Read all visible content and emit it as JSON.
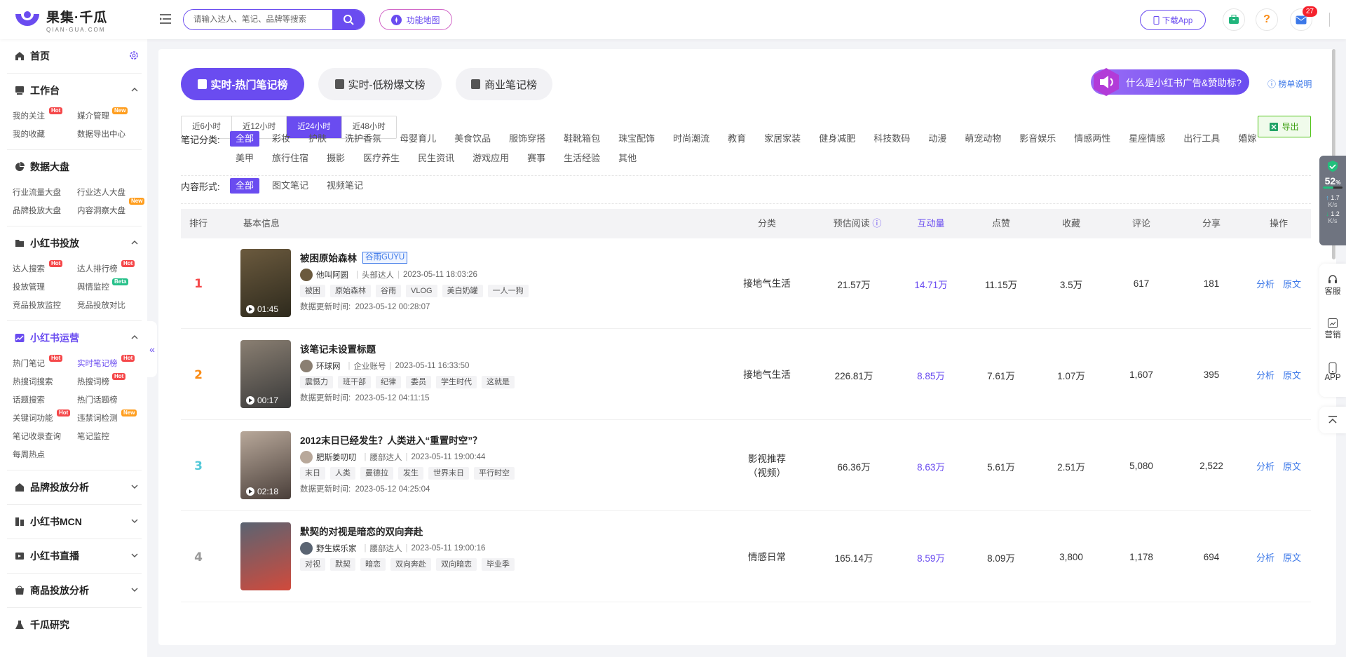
{
  "brand": {
    "name": "果集·千瓜",
    "domain": "QIAN-GUA.COM"
  },
  "header": {
    "search_placeholder": "请输入达人、笔记、品牌等搜索",
    "func_map": "功能地图",
    "download_app": "下载App",
    "message_count": "27"
  },
  "sidebar": {
    "home": "首页",
    "sections": [
      {
        "title": "工作台",
        "items": [
          {
            "label": "我的关注",
            "tag": "Hot"
          },
          {
            "label": "媒介管理",
            "tag": "New"
          },
          {
            "label": "我的收藏",
            "tag": ""
          },
          {
            "label": "数据导出中心",
            "tag": ""
          }
        ]
      },
      {
        "title": "数据大盘",
        "items": [
          {
            "label": "行业流量大盘",
            "tag": ""
          },
          {
            "label": "行业达人大盘",
            "tag": ""
          },
          {
            "label": "品牌投放大盘",
            "tag": ""
          },
          {
            "label": "内容洞察大盘",
            "tag": "New"
          }
        ]
      },
      {
        "title": "小红书投放",
        "items": [
          {
            "label": "达人搜索",
            "tag": "Hot"
          },
          {
            "label": "达人排行榜",
            "tag": "Hot"
          },
          {
            "label": "投放管理",
            "tag": ""
          },
          {
            "label": "舆情监控",
            "tag": "Beta"
          },
          {
            "label": "竞品投放监控",
            "tag": ""
          },
          {
            "label": "竞品投放对比",
            "tag": ""
          }
        ]
      },
      {
        "title": "小红书运营",
        "items": [
          {
            "label": "热门笔记",
            "tag": "Hot"
          },
          {
            "label": "实时笔记榜",
            "tag": "Hot"
          },
          {
            "label": "热搜词搜索",
            "tag": ""
          },
          {
            "label": "热搜词榜",
            "tag": "Hot"
          },
          {
            "label": "话题搜索",
            "tag": ""
          },
          {
            "label": "热门话题榜",
            "tag": ""
          },
          {
            "label": "关键词功能",
            "tag": "Hot"
          },
          {
            "label": "违禁词检测",
            "tag": "New"
          },
          {
            "label": "笔记收录查询",
            "tag": ""
          },
          {
            "label": "笔记监控",
            "tag": ""
          },
          {
            "label": "每周热点",
            "tag": ""
          }
        ]
      }
    ],
    "collapsed": [
      "品牌投放分析",
      "小红书MCN",
      "小红书直播",
      "商品投放分析",
      "千瓜研究"
    ]
  },
  "tabs": [
    "实时-热门笔记榜",
    "实时-低粉爆文榜",
    "商业笔记榜"
  ],
  "ad_banner": "什么是小红书广告&赞助标?",
  "rule_link": "榜单说明",
  "time_filters": [
    "近6小时",
    "近12小时",
    "近24小时",
    "近48小时"
  ],
  "export_label": "导出",
  "category_label": "笔记分类:",
  "categories_line1": [
    "全部",
    "彩妆",
    "护肤",
    "洗护香氛",
    "母婴育儿",
    "美食饮品",
    "服饰穿搭",
    "鞋靴箱包",
    "珠宝配饰",
    "时尚潮流",
    "教育",
    "家居家装",
    "健身减肥",
    "科技数码",
    "动漫",
    "萌宠动物",
    "影音娱乐",
    "情感两性",
    "星座情感",
    "出行工具",
    "婚嫁"
  ],
  "categories_line2": [
    "美甲",
    "旅行住宿",
    "摄影",
    "医疗养生",
    "民生资讯",
    "游戏应用",
    "赛事",
    "生活经验",
    "其他"
  ],
  "format_label": "内容形式:",
  "formats": [
    "全部",
    "图文笔记",
    "视频笔记"
  ],
  "table": {
    "headers": [
      "排行",
      "基本信息",
      "分类",
      "预估阅读",
      "互动量",
      "点赞",
      "收藏",
      "评论",
      "分享",
      "操作"
    ],
    "update_prefix": "数据更新时间:",
    "op_analyze": "分析",
    "op_original": "原文",
    "rows": [
      {
        "rank": "1",
        "rank_color": "#f5484a",
        "title": "被困原始森林",
        "brand": "谷雨GUYU",
        "author": "他叫阿圆",
        "level": "头部达人",
        "time": "2023-05-11 18:03:26",
        "keywords": [
          "被困",
          "原始森林",
          "谷雨",
          "VLOG",
          "美白奶罐",
          "一人一狗"
        ],
        "updated": "2023-05-12 00:28:07",
        "duration": "01:45",
        "category": "接地气生活",
        "read": "21.57万",
        "interact": "14.71万",
        "like": "11.15万",
        "collect": "3.5万",
        "comment": "617",
        "share": "181"
      },
      {
        "rank": "2",
        "rank_color": "#fa8c16",
        "title": "该笔记未设置标题",
        "brand": "",
        "author": "环球网",
        "level": "企业账号",
        "time": "2023-05-11 16:33:50",
        "keywords": [
          "震慑力",
          "班干部",
          "纪律",
          "委员",
          "学生时代",
          "这就是"
        ],
        "updated": "2023-05-12 04:11:15",
        "duration": "00:17",
        "category": "接地气生活",
        "read": "226.81万",
        "interact": "8.85万",
        "like": "7.61万",
        "collect": "1.07万",
        "comment": "1,607",
        "share": "395"
      },
      {
        "rank": "3",
        "rank_color": "#52c8d8",
        "title": "2012末日已经发生？人类进入“重置时空”？",
        "brand": "",
        "author": "肥斯姜叨叨",
        "level": "腰部达人",
        "time": "2023-05-11 19:00:44",
        "keywords": [
          "末日",
          "人类",
          "曼德拉",
          "发生",
          "世界末日",
          "平行时空"
        ],
        "updated": "2023-05-12 04:25:04",
        "duration": "02:18",
        "category": "影视推荐（视频）",
        "read": "66.36万",
        "interact": "8.63万",
        "like": "5.61万",
        "collect": "2.51万",
        "comment": "5,080",
        "share": "2,522"
      },
      {
        "rank": "4",
        "rank_color": "#999999",
        "title": "默契的对视是暗恋的双向奔赴",
        "brand": "",
        "author": "野生娱乐家",
        "level": "腰部达人",
        "time": "2023-05-11 19:00:16",
        "keywords": [
          "对视",
          "默契",
          "暗恋",
          "双向奔赴",
          "双向暗恋",
          "毕业季"
        ],
        "updated": "",
        "duration": "",
        "category": "情感日常",
        "read": "165.14万",
        "interact": "8.59万",
        "like": "8.09万",
        "collect": "3,800",
        "comment": "1,178",
        "share": "694"
      }
    ]
  },
  "net_widget": {
    "percent": "52",
    "unit": "%",
    "up": "1.7",
    "down": "1.2",
    "rate_unit": "K/s"
  },
  "side_tools": [
    "客服",
    "营销",
    "APP"
  ]
}
